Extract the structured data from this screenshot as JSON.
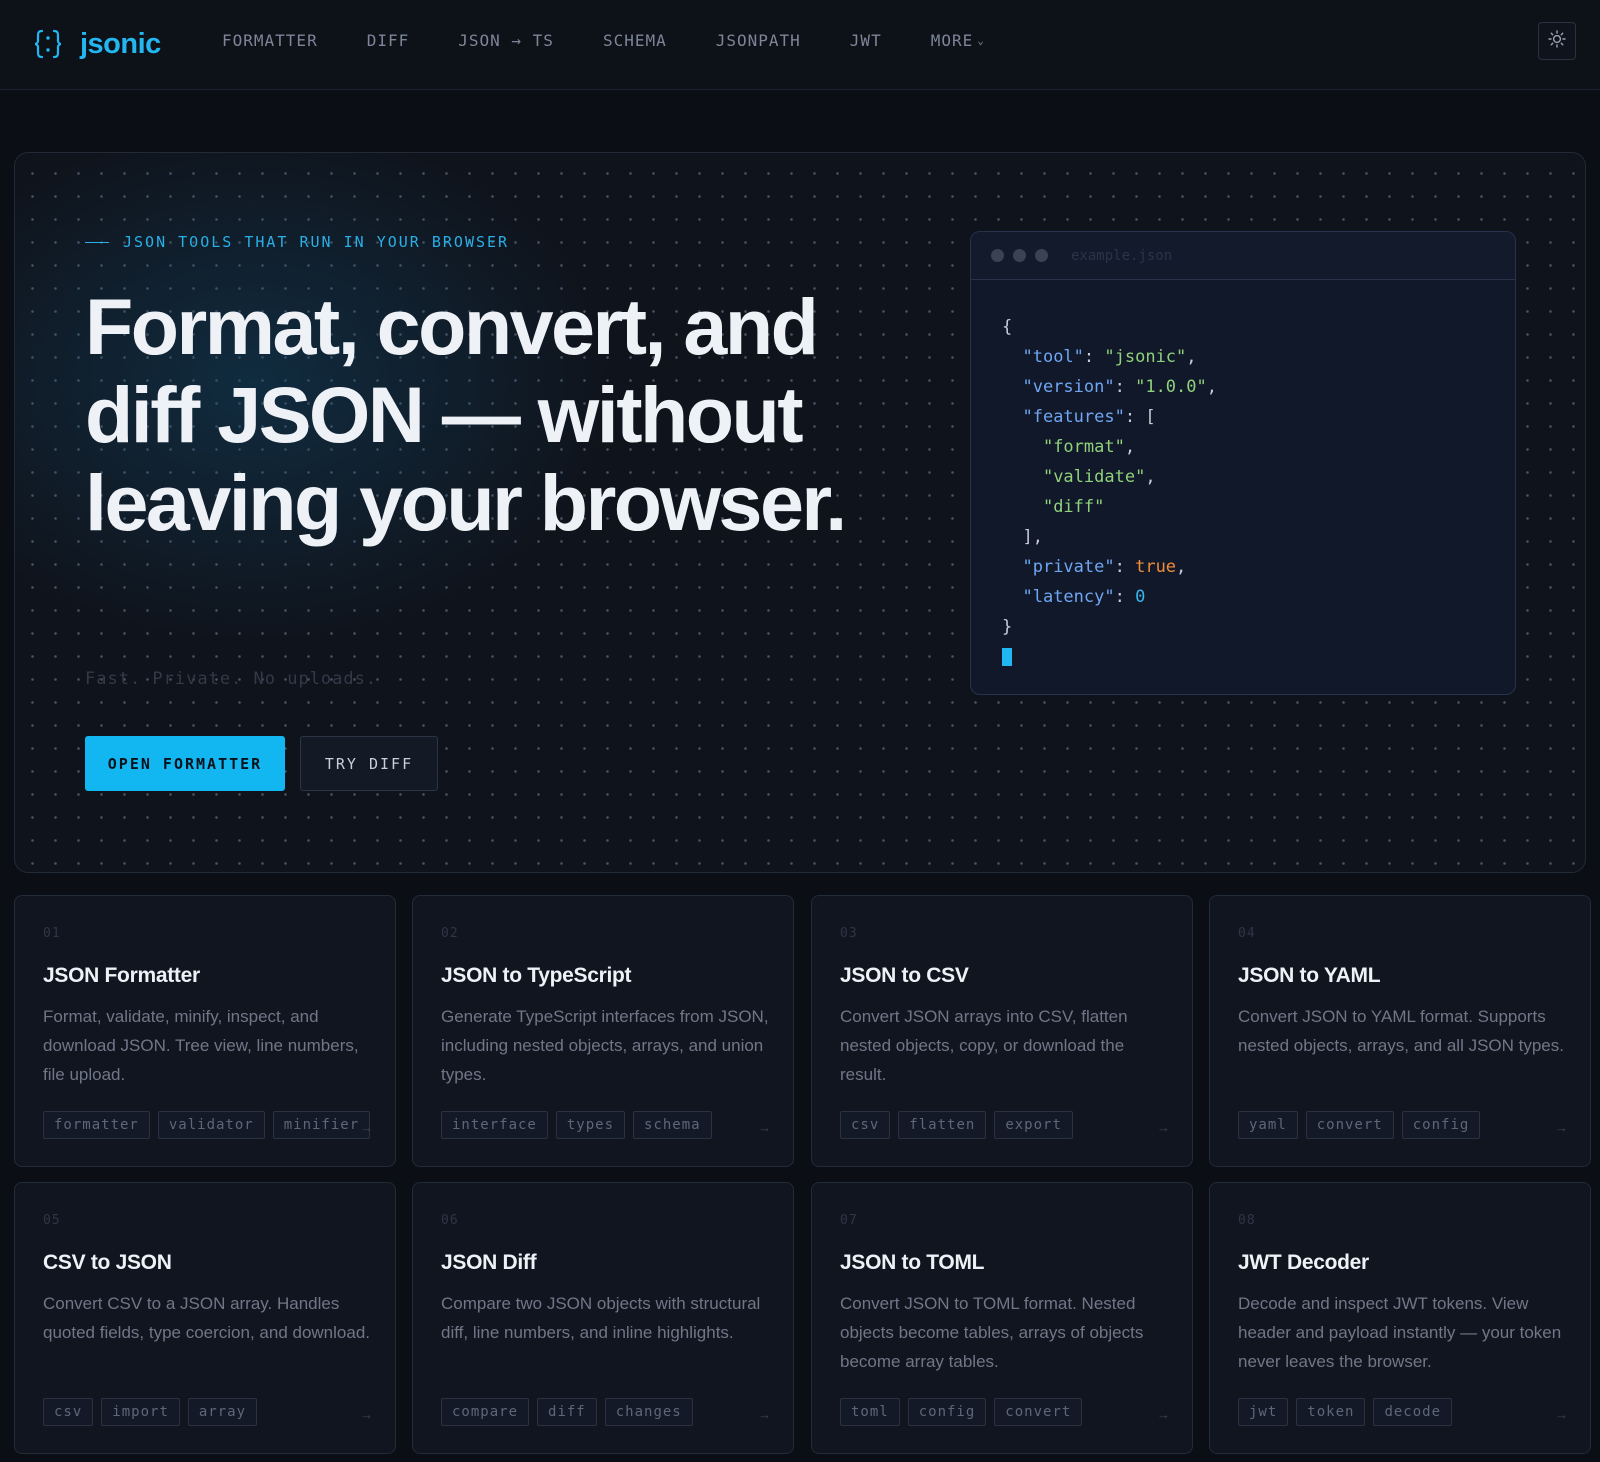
{
  "header": {
    "logo_text": "jsonic",
    "nav": [
      {
        "label": "FORMATTER"
      },
      {
        "label": "DIFF"
      },
      {
        "label": "JSON → TS"
      },
      {
        "label": "SCHEMA"
      },
      {
        "label": "JSONPATH"
      },
      {
        "label": "JWT"
      },
      {
        "label": "MORE"
      }
    ],
    "theme_icon": "sun-icon"
  },
  "hero": {
    "eyebrow": "JSON TOOLS THAT RUN IN YOUR BROWSER",
    "headline": "Format, convert, and diff JSON — without leaving your browser.",
    "subline": "Fast. Private. No uploads.",
    "primary_button": "OPEN FORMATTER",
    "secondary_button": "TRY DIFF",
    "code_window": {
      "filename": "example.json",
      "lines": [
        [
          {
            "t": "p",
            "v": "{"
          }
        ],
        [
          {
            "t": "p",
            "v": "  "
          },
          {
            "t": "k",
            "v": "\"tool\""
          },
          {
            "t": "p",
            "v": ": "
          },
          {
            "t": "s",
            "v": "\"jsonic\""
          },
          {
            "t": "p",
            "v": ","
          }
        ],
        [
          {
            "t": "p",
            "v": "  "
          },
          {
            "t": "k",
            "v": "\"version\""
          },
          {
            "t": "p",
            "v": ": "
          },
          {
            "t": "s",
            "v": "\"1.0.0\""
          },
          {
            "t": "p",
            "v": ","
          }
        ],
        [
          {
            "t": "p",
            "v": "  "
          },
          {
            "t": "k",
            "v": "\"features\""
          },
          {
            "t": "p",
            "v": ": ["
          }
        ],
        [
          {
            "t": "p",
            "v": "    "
          },
          {
            "t": "s",
            "v": "\"format\""
          },
          {
            "t": "p",
            "v": ","
          }
        ],
        [
          {
            "t": "p",
            "v": "    "
          },
          {
            "t": "s",
            "v": "\"validate\""
          },
          {
            "t": "p",
            "v": ","
          }
        ],
        [
          {
            "t": "p",
            "v": "    "
          },
          {
            "t": "s",
            "v": "\"diff\""
          }
        ],
        [
          {
            "t": "p",
            "v": "  ],"
          }
        ],
        [
          {
            "t": "p",
            "v": "  "
          },
          {
            "t": "k",
            "v": "\"private\""
          },
          {
            "t": "p",
            "v": ": "
          },
          {
            "t": "b",
            "v": "true"
          },
          {
            "t": "p",
            "v": ","
          }
        ],
        [
          {
            "t": "p",
            "v": "  "
          },
          {
            "t": "k",
            "v": "\"latency\""
          },
          {
            "t": "p",
            "v": ": "
          },
          {
            "t": "n",
            "v": "0"
          }
        ],
        [
          {
            "t": "p",
            "v": "}"
          }
        ]
      ]
    }
  },
  "tools": [
    {
      "num": "01",
      "title": "JSON Formatter",
      "desc": "Format, validate, minify, inspect, and download JSON. Tree view, line numbers, file upload.",
      "tags": [
        "formatter",
        "validator",
        "minifier"
      ]
    },
    {
      "num": "02",
      "title": "JSON to TypeScript",
      "desc": "Generate TypeScript interfaces from JSON, including nested objects, arrays, and union types.",
      "tags": [
        "interface",
        "types",
        "schema"
      ]
    },
    {
      "num": "03",
      "title": "JSON to CSV",
      "desc": "Convert JSON arrays into CSV, flatten nested objects, copy, or download the result.",
      "tags": [
        "csv",
        "flatten",
        "export"
      ]
    },
    {
      "num": "04",
      "title": "JSON to YAML",
      "desc": "Convert JSON to YAML format. Supports nested objects, arrays, and all JSON types.",
      "tags": [
        "yaml",
        "convert",
        "config"
      ]
    },
    {
      "num": "05",
      "title": "CSV to JSON",
      "desc": "Convert CSV to a JSON array. Handles quoted fields, type coercion, and download.",
      "tags": [
        "csv",
        "import",
        "array"
      ]
    },
    {
      "num": "06",
      "title": "JSON Diff",
      "desc": "Compare two JSON objects with structural diff, line numbers, and inline highlights.",
      "tags": [
        "compare",
        "diff",
        "changes"
      ]
    },
    {
      "num": "07",
      "title": "JSON to TOML",
      "desc": "Convert JSON to TOML format. Nested objects become tables, arrays of objects become array tables.",
      "tags": [
        "toml",
        "config",
        "convert"
      ]
    },
    {
      "num": "08",
      "title": "JWT Decoder",
      "desc": "Decode and inspect JWT tokens. View header and payload instantly — your token never leaves the browser.",
      "tags": [
        "jwt",
        "token",
        "decode"
      ]
    }
  ],
  "colors": {
    "accent": "#12b6f0",
    "background": "#0b0e14",
    "json_key": "#6fa6f2",
    "json_string": "#8fd17c",
    "json_boolean": "#f08c3c",
    "json_number": "#37b6ee"
  }
}
